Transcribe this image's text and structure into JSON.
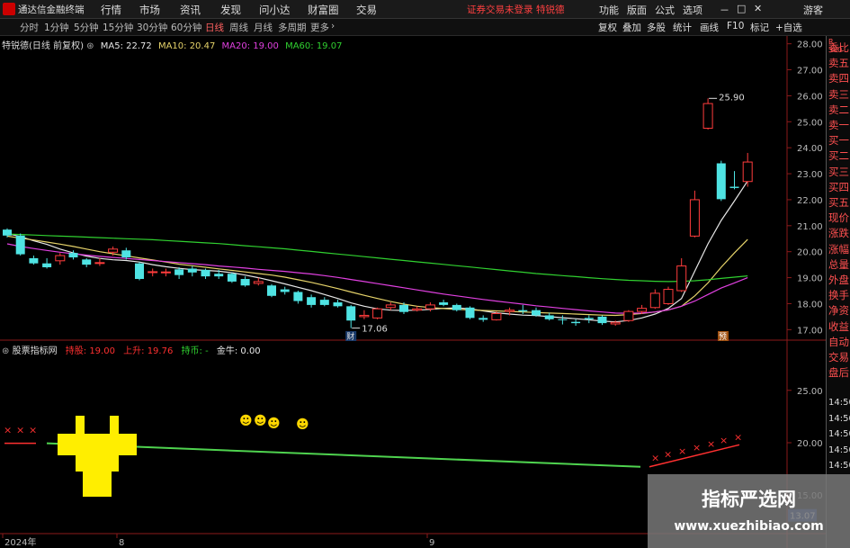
{
  "app": {
    "title": "通达信金融终端",
    "menus": [
      "行情",
      "市场",
      "资讯",
      "发现",
      "问小达",
      "财富圈",
      "交易"
    ],
    "warning": "证券交易未登录",
    "stock_name": "特锐德",
    "right_menus": [
      "功能",
      "版面",
      "公式",
      "选项"
    ],
    "window_controls": [
      "－",
      "□",
      "✕"
    ],
    "guest": "游客"
  },
  "tabs": {
    "periods": [
      "分时",
      "1分钟",
      "5分钟",
      "15分钟",
      "30分钟",
      "60分钟",
      "日线",
      "周线",
      "月线",
      "多周期",
      "更多"
    ],
    "active": "日线",
    "more_arrow": "›",
    "tools": [
      "复权",
      "叠加",
      "多股",
      "统计",
      "画线",
      "F10",
      "标记",
      "+自选"
    ]
  },
  "sidebar": {
    "top_tag": "R 300",
    "items": [
      "委比",
      "卖五",
      "卖四",
      "卖三",
      "卖二",
      "卖一",
      "买一",
      "买二",
      "买三",
      "买四",
      "买五",
      "现价",
      "涨跌",
      "涨幅",
      "总量",
      "外盘",
      "换手",
      "净资",
      "收益",
      "自动",
      "交易",
      "盘后"
    ],
    "times": [
      "14:50",
      "14:50",
      "14:50",
      "14:50",
      "14:50"
    ]
  },
  "legend_main": {
    "title": "特锐德(日线 前复权)",
    "items": [
      {
        "label": "MA5: 22.72",
        "color": "#e6e6e6"
      },
      {
        "label": "MA10: 20.47",
        "color": "#e6d36a"
      },
      {
        "label": "MA20: 19.00",
        "color": "#e040e0"
      },
      {
        "label": "MA60: 19.07",
        "color": "#30d030"
      }
    ]
  },
  "legend_sub": {
    "title": "股票指标网",
    "items": [
      {
        "label": "持股: 19.00",
        "color": "#ff3030"
      },
      {
        "label": "上升: 19.76",
        "color": "#ff3030"
      },
      {
        "label": "持币: -",
        "color": "#30d030"
      },
      {
        "label": "金牛: 0.00",
        "color": "#e6e6e6"
      }
    ]
  },
  "chart_data": [
    {
      "type": "candlestick",
      "title": "特锐德(日线 前复权)",
      "yticks": [
        17.0,
        18.0,
        19.0,
        20.0,
        21.0,
        22.0,
        23.0,
        24.0,
        25.0,
        26.0,
        27.0,
        28.0
      ],
      "ylim": [
        16.7,
        28.3
      ],
      "xticks": [
        "2024年",
        "8",
        "9"
      ],
      "annotations": [
        "25.90",
        "17.06",
        "财",
        "预"
      ],
      "candles": [
        [
          20.85,
          20.62,
          20.9,
          20.55
        ],
        [
          20.62,
          19.9,
          20.7,
          19.85
        ],
        [
          19.75,
          19.55,
          19.85,
          19.5
        ],
        [
          19.55,
          19.4,
          19.75,
          19.35
        ],
        [
          19.65,
          19.85,
          19.95,
          19.5
        ],
        [
          19.95,
          19.78,
          20.05,
          19.7
        ],
        [
          19.7,
          19.5,
          19.75,
          19.4
        ],
        [
          19.55,
          19.58,
          19.75,
          19.45
        ],
        [
          19.98,
          20.1,
          20.2,
          19.85
        ],
        [
          20.05,
          19.78,
          20.15,
          19.7
        ],
        [
          19.55,
          18.95,
          19.6,
          18.9
        ],
        [
          19.2,
          19.23,
          19.35,
          19.05
        ],
        [
          19.2,
          19.22,
          19.35,
          19.05
        ],
        [
          19.32,
          19.1,
          19.4,
          18.95
        ],
        [
          19.35,
          19.2,
          19.45,
          19.05
        ],
        [
          19.3,
          19.05,
          19.35,
          18.95
        ],
        [
          19.15,
          19.05,
          19.3,
          18.95
        ],
        [
          19.15,
          18.85,
          19.2,
          18.8
        ],
        [
          18.95,
          18.7,
          19.05,
          18.65
        ],
        [
          18.78,
          18.85,
          19.0,
          18.7
        ],
        [
          18.7,
          18.3,
          18.75,
          18.25
        ],
        [
          18.55,
          18.45,
          18.65,
          18.35
        ],
        [
          18.45,
          18.1,
          18.5,
          18.0
        ],
        [
          18.25,
          17.95,
          18.35,
          17.85
        ],
        [
          18.15,
          17.95,
          18.25,
          17.9
        ],
        [
          18.05,
          17.9,
          18.15,
          17.85
        ],
        [
          17.9,
          17.35,
          17.95,
          17.06
        ],
        [
          17.5,
          17.55,
          17.75,
          17.4
        ],
        [
          17.45,
          17.8,
          17.85,
          17.4
        ],
        [
          17.85,
          17.95,
          18.05,
          17.75
        ],
        [
          17.95,
          17.68,
          18.05,
          17.6
        ],
        [
          17.75,
          17.8,
          17.9,
          17.7
        ],
        [
          17.8,
          17.95,
          18.05,
          17.7
        ],
        [
          18.05,
          17.95,
          18.15,
          17.9
        ],
        [
          17.95,
          17.75,
          18.0,
          17.7
        ],
        [
          17.85,
          17.45,
          17.9,
          17.4
        ],
        [
          17.45,
          17.38,
          17.55,
          17.3
        ],
        [
          17.38,
          17.62,
          17.7,
          17.35
        ],
        [
          17.7,
          17.75,
          17.85,
          17.55
        ],
        [
          17.75,
          17.7,
          17.95,
          17.6
        ],
        [
          17.75,
          17.55,
          17.85,
          17.5
        ],
        [
          17.55,
          17.4,
          17.65,
          17.35
        ],
        [
          17.4,
          17.38,
          17.55,
          17.2
        ],
        [
          17.3,
          17.25,
          17.4,
          17.15
        ],
        [
          17.45,
          17.4,
          17.55,
          17.25
        ],
        [
          17.5,
          17.25,
          17.55,
          17.18
        ],
        [
          17.22,
          17.28,
          17.35,
          17.15
        ],
        [
          17.35,
          17.7,
          17.75,
          17.3
        ],
        [
          17.7,
          17.82,
          17.95,
          17.6
        ],
        [
          17.85,
          18.4,
          18.55,
          17.8
        ],
        [
          18.0,
          18.55,
          18.65,
          17.95
        ],
        [
          18.5,
          19.45,
          19.75,
          18.45
        ],
        [
          20.6,
          22.0,
          22.35,
          20.55
        ],
        [
          24.75,
          25.7,
          25.9,
          24.7
        ],
        [
          23.4,
          22.02,
          23.5,
          21.95
        ],
        [
          22.5,
          22.45,
          23.1,
          22.4
        ],
        [
          22.7,
          23.45,
          23.8,
          22.5
        ]
      ],
      "ma_series": [
        {
          "name": "MA5",
          "values": [
            20.7,
            20.58,
            20.42,
            20.28,
            20.1,
            19.95,
            19.83,
            19.74,
            19.69,
            19.66,
            19.6,
            19.5,
            19.42,
            19.36,
            19.31,
            19.28,
            19.25,
            19.19,
            19.1,
            19.0,
            18.88,
            18.76,
            18.63,
            18.5,
            18.35,
            18.2,
            18.03,
            17.9,
            17.8,
            17.75,
            17.74,
            17.75,
            17.78,
            17.82,
            17.84,
            17.8,
            17.72,
            17.65,
            17.6,
            17.56,
            17.54,
            17.5,
            17.46,
            17.42,
            17.38,
            17.33,
            17.3,
            17.35,
            17.45,
            17.6,
            17.82,
            18.2,
            19.25,
            20.3,
            21.2,
            21.95,
            22.72
          ]
        },
        {
          "name": "MA10",
          "values": [
            20.6,
            20.52,
            20.45,
            20.37,
            20.29,
            20.2,
            20.1,
            20.0,
            19.92,
            19.84,
            19.76,
            19.68,
            19.6,
            19.52,
            19.46,
            19.4,
            19.34,
            19.28,
            19.22,
            19.16,
            19.1,
            19.02,
            18.92,
            18.82,
            18.7,
            18.58,
            18.45,
            18.32,
            18.2,
            18.08,
            17.98,
            17.9,
            17.85,
            17.81,
            17.78,
            17.76,
            17.74,
            17.72,
            17.7,
            17.68,
            17.66,
            17.64,
            17.62,
            17.6,
            17.58,
            17.56,
            17.55,
            17.58,
            17.62,
            17.68,
            17.76,
            17.9,
            18.3,
            18.8,
            19.4,
            19.95,
            20.47
          ]
        },
        {
          "name": "MA20",
          "values": [
            20.3,
            20.2,
            20.12,
            20.05,
            19.98,
            19.92,
            19.87,
            19.82,
            19.78,
            19.74,
            19.7,
            19.66,
            19.62,
            19.58,
            19.54,
            19.5,
            19.45,
            19.41,
            19.37,
            19.32,
            19.28,
            19.24,
            19.19,
            19.14,
            19.08,
            19.01,
            18.93,
            18.85,
            18.77,
            18.69,
            18.61,
            18.53,
            18.45,
            18.37,
            18.3,
            18.23,
            18.16,
            18.1,
            18.04,
            17.98,
            17.92,
            17.87,
            17.82,
            17.77,
            17.72,
            17.68,
            17.64,
            17.63,
            17.64,
            17.68,
            17.76,
            17.9,
            18.1,
            18.35,
            18.6,
            18.8,
            19.0
          ]
        },
        {
          "name": "MA60",
          "values": [
            20.68,
            20.66,
            20.64,
            20.62,
            20.6,
            20.58,
            20.56,
            20.54,
            20.52,
            20.5,
            20.48,
            20.46,
            20.43,
            20.4,
            20.37,
            20.34,
            20.31,
            20.27,
            20.23,
            20.19,
            20.15,
            20.11,
            20.06,
            20.01,
            19.96,
            19.91,
            19.86,
            19.81,
            19.76,
            19.71,
            19.66,
            19.61,
            19.56,
            19.51,
            19.46,
            19.41,
            19.36,
            19.31,
            19.26,
            19.21,
            19.16,
            19.12,
            19.08,
            19.04,
            19.0,
            18.96,
            18.93,
            18.9,
            18.88,
            18.86,
            18.85,
            18.86,
            18.88,
            18.92,
            18.97,
            19.02,
            19.07
          ]
        }
      ]
    },
    {
      "type": "line",
      "title": "股票指标网",
      "yticks": [
        15.0,
        20.0,
        25.0
      ],
      "ylim": [
        11.5,
        28.5
      ],
      "last_value_tag": "13.07",
      "line": {
        "name": "持币",
        "values_start": 19.95,
        "values_end": 17.7
      },
      "markers": [
        "×",
        "☻",
        "↑"
      ]
    }
  ],
  "watermark": {
    "title": "指标严选网",
    "url": "www.xuezhibiao.com"
  }
}
